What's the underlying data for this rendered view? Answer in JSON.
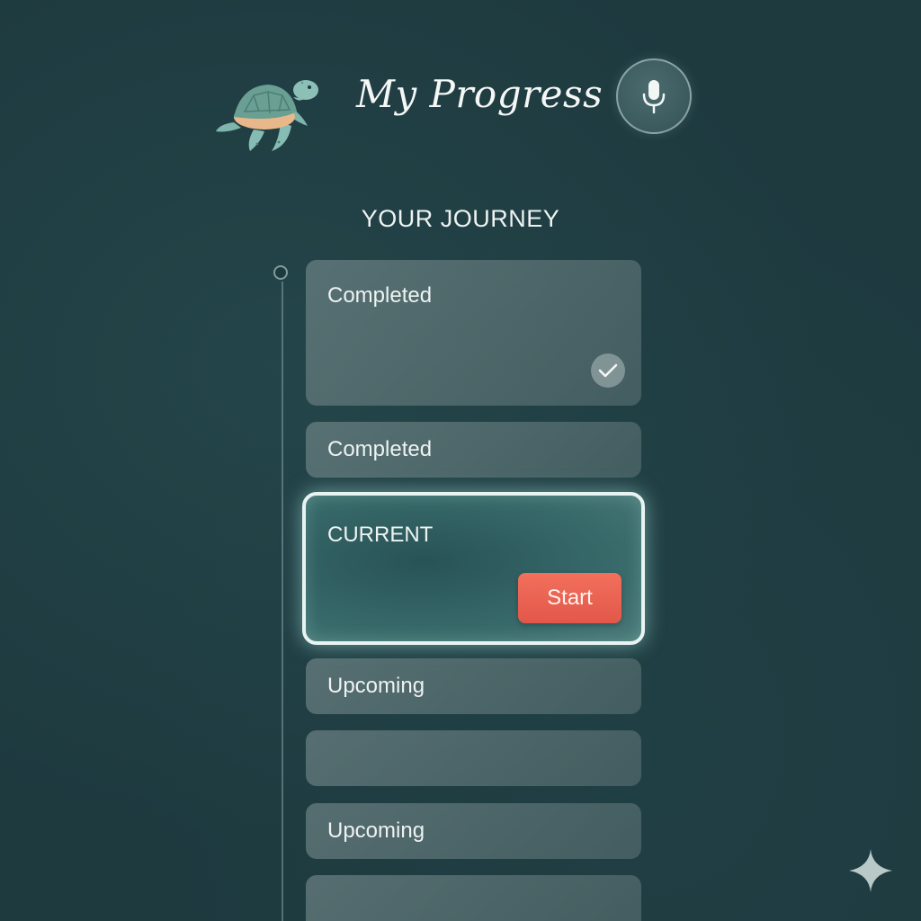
{
  "header": {
    "title": "My Progress",
    "logo_icon": "turtle-icon",
    "mic_icon": "microphone-icon"
  },
  "journey": {
    "heading": "YOUR JOURNEY",
    "steps": [
      {
        "label": "Completed",
        "status": "completed",
        "icon": "check-icon"
      },
      {
        "label": "Completed",
        "status": "completed"
      },
      {
        "label": "CURRENT",
        "status": "current",
        "action_label": "Start"
      },
      {
        "label": "Upcoming",
        "status": "upcoming"
      },
      {
        "label": "",
        "status": "upcoming"
      },
      {
        "label": "Upcoming",
        "status": "upcoming"
      },
      {
        "label": "",
        "status": "upcoming"
      }
    ]
  },
  "footer": {
    "corner_icon": "sparkle-icon"
  },
  "colors": {
    "background": "#1e3a3f",
    "card": "#6f8587",
    "current_border": "#e8f4f2",
    "accent": "#e9604f"
  }
}
